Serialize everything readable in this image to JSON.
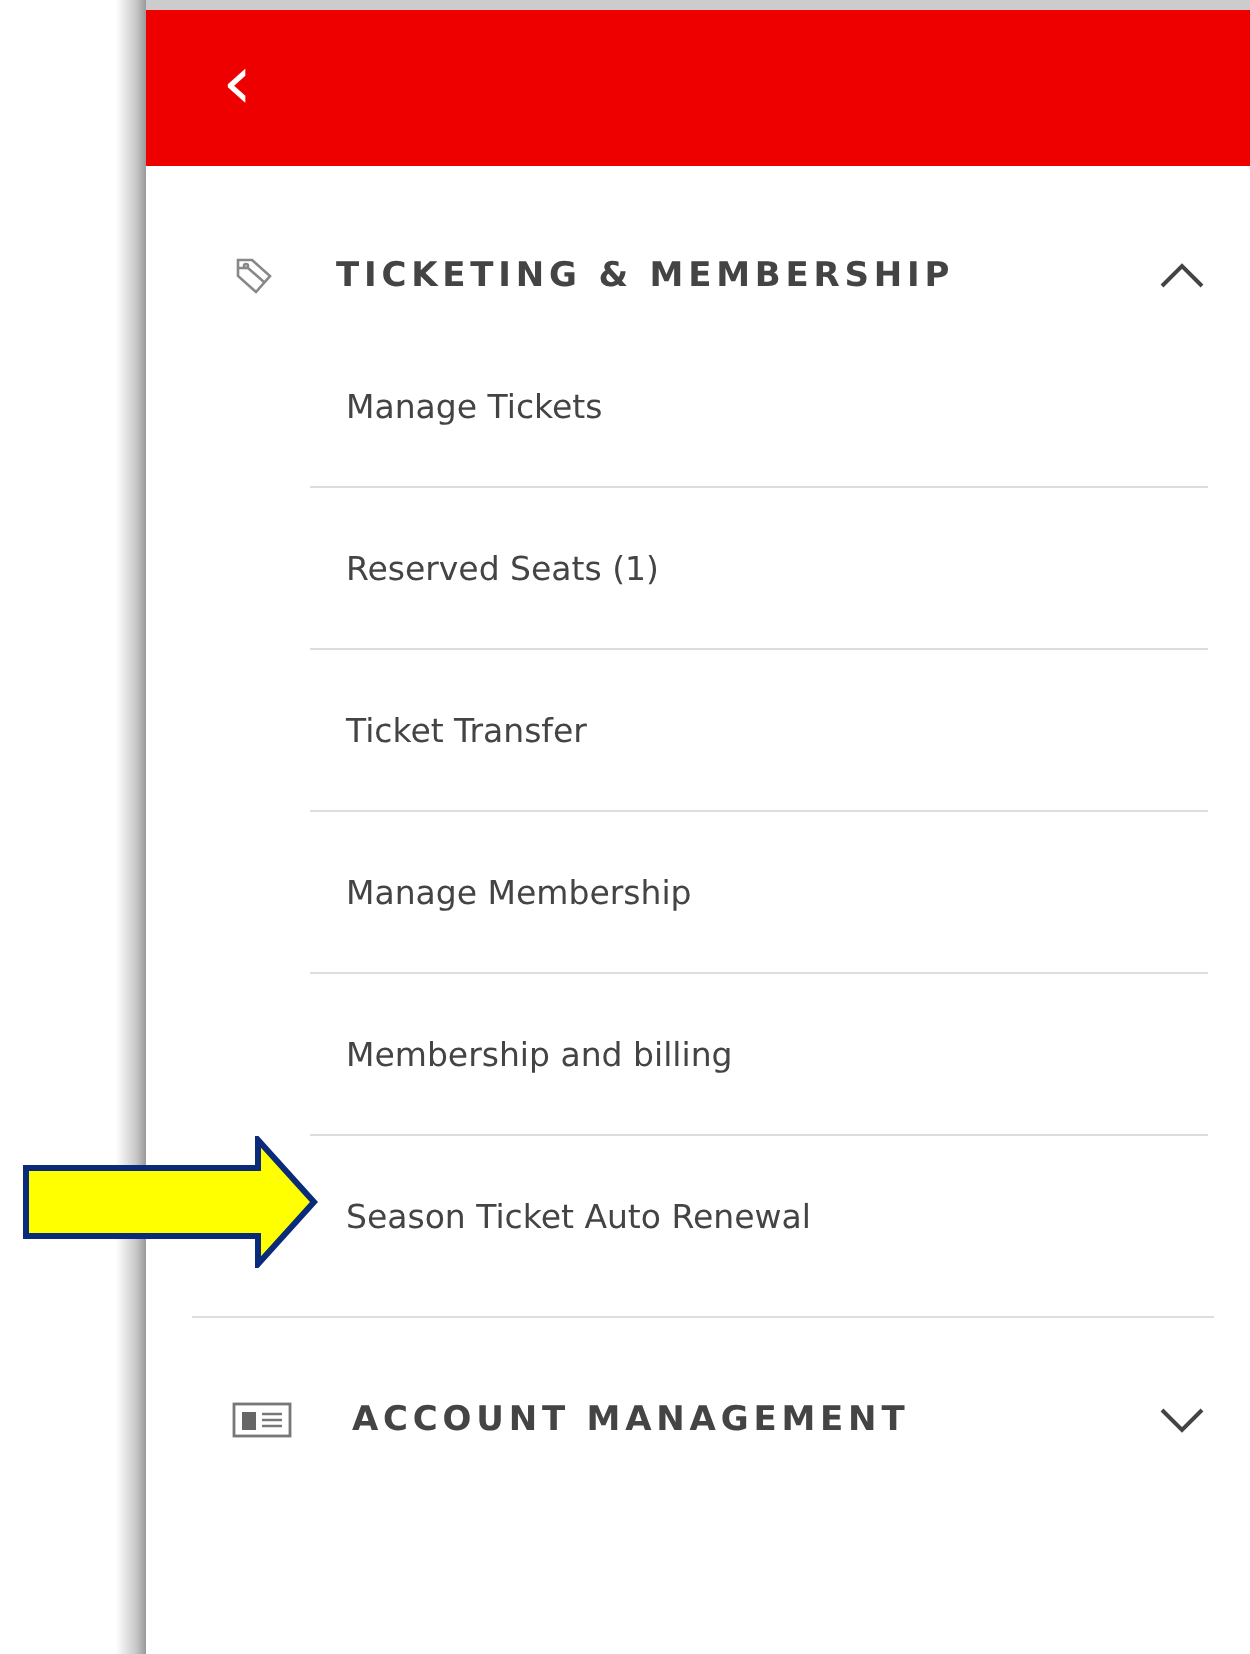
{
  "header": {
    "back": "‹"
  },
  "sections": [
    {
      "title": "TICKETING & MEMBERSHIP",
      "expanded": true,
      "items": [
        {
          "label": "Manage Tickets"
        },
        {
          "label": "Reserved Seats (1)"
        },
        {
          "label": "Ticket Transfer"
        },
        {
          "label": "Manage Membership"
        },
        {
          "label": "Membership and billing"
        },
        {
          "label": "Season Ticket Auto Renewal"
        }
      ]
    },
    {
      "title": "ACCOUNT MANAGEMENT",
      "expanded": false
    }
  ]
}
